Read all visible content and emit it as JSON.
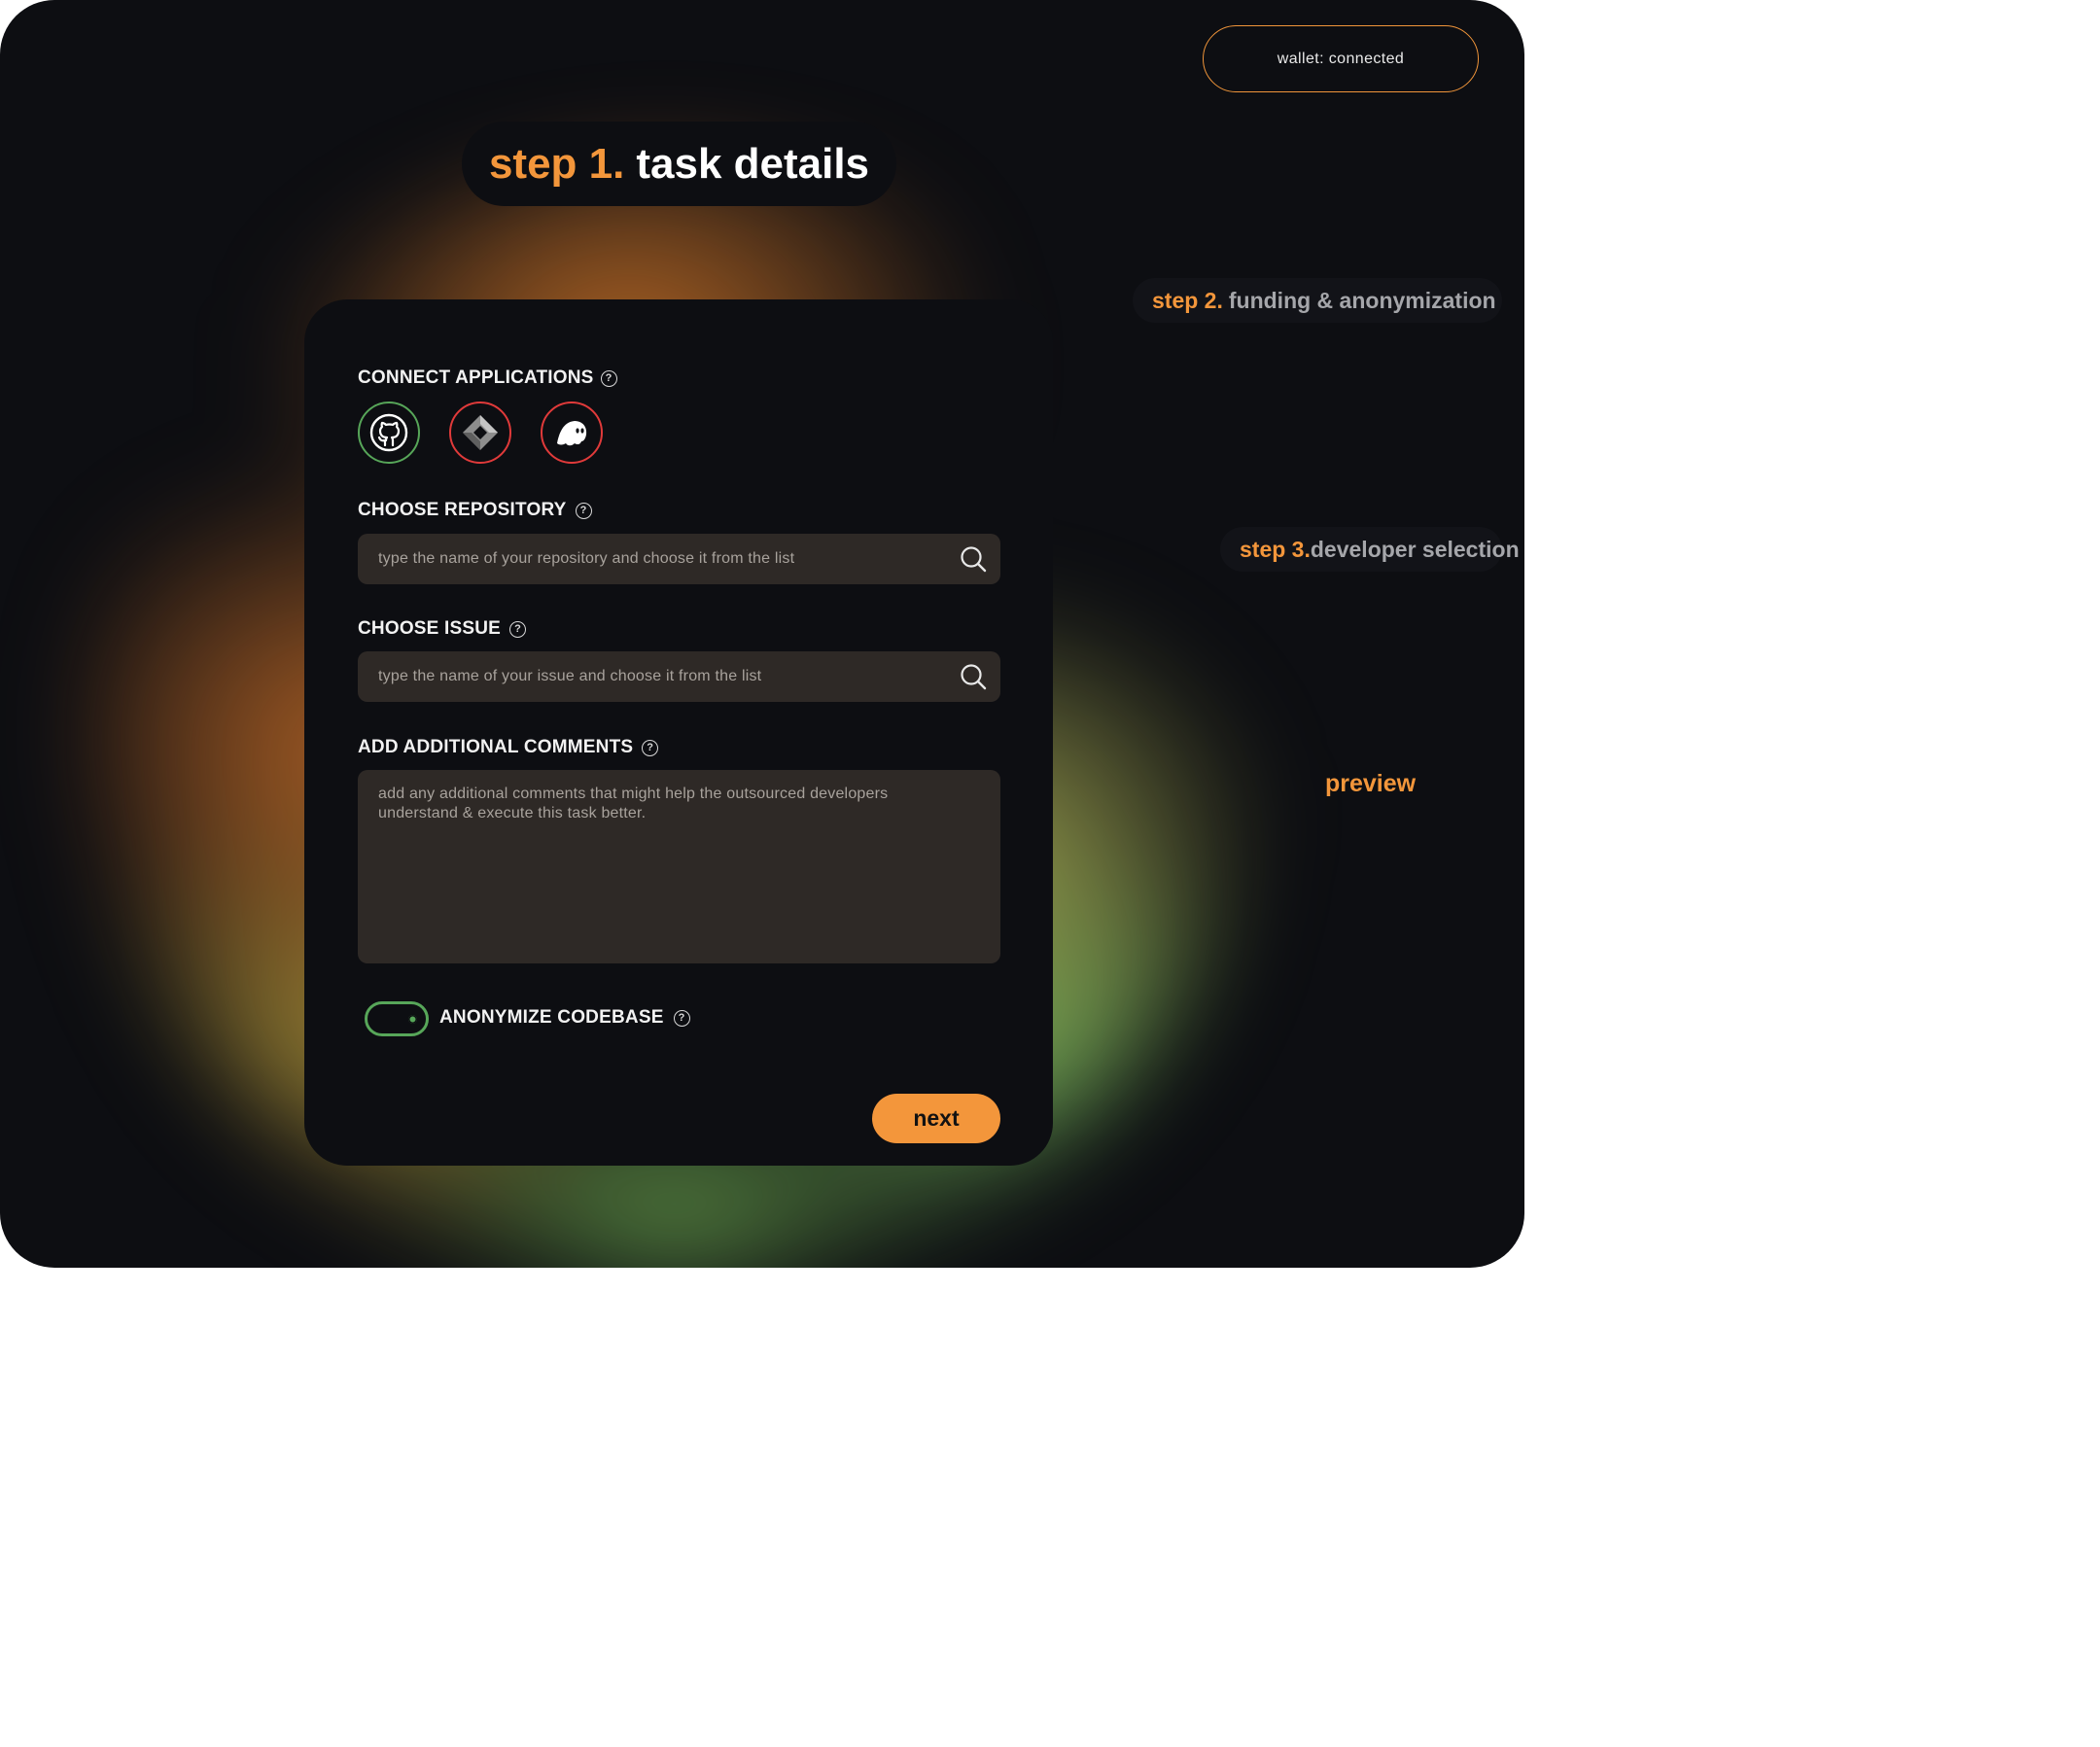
{
  "header": {
    "wallet_status": "wallet: connected"
  },
  "steps": {
    "step1": {
      "number": "step 1.",
      "title": "task details"
    },
    "step2": {
      "number": "step 2.",
      "title": "funding & anonymization"
    },
    "step3": {
      "number": "step 3.",
      "title": "developer selection"
    },
    "preview": "preview"
  },
  "form": {
    "connect_label": "CONNECT APPLICATIONS",
    "apps": [
      {
        "name": "github",
        "icon": "github-icon",
        "status_color": "#57a659"
      },
      {
        "name": "jira",
        "icon": "jira-icon",
        "status_color": "#e03a3a"
      },
      {
        "name": "ghost",
        "icon": "ghost-icon",
        "status_color": "#e03a3a"
      }
    ],
    "repository": {
      "label": "CHOOSE REPOSITORY",
      "placeholder": "type the name of your repository and choose it from the list"
    },
    "issue": {
      "label": "CHOOSE ISSUE",
      "placeholder": "type the name of your issue and choose it from the list"
    },
    "comments": {
      "label": "ADD ADDITIONAL COMMENTS",
      "placeholder": "add any additional comments that might help the outsourced developers understand & execute this task better."
    },
    "anonymize": {
      "label": "ANONYMIZE CODEBASE",
      "enabled": true
    },
    "next_label": "next",
    "help_glyph": "?"
  },
  "colors": {
    "accent": "#f3963b",
    "success": "#57a659",
    "error": "#e03a3a",
    "background": "#0d0e12",
    "field": "#2e2926"
  }
}
